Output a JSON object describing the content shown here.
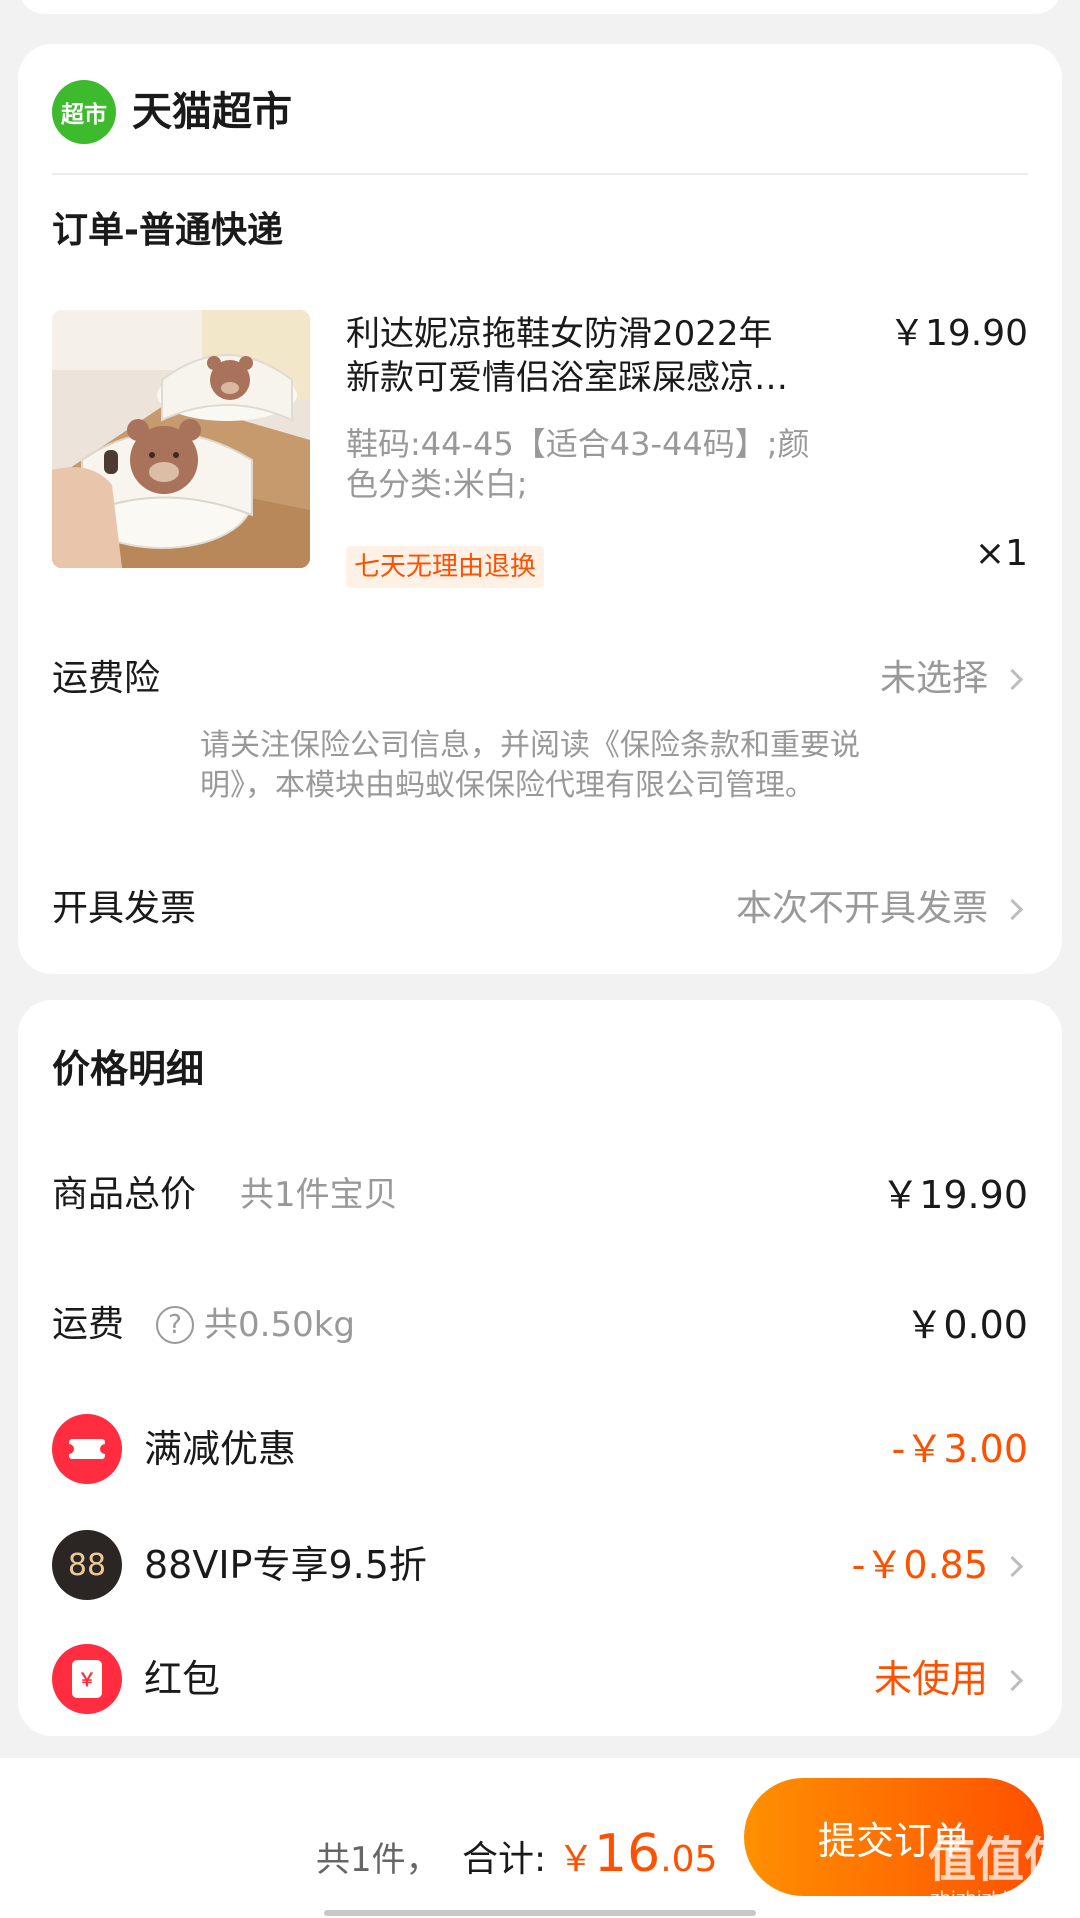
{
  "store": {
    "logo_text": "超市",
    "name": "天猫超市",
    "logo_color": "#3dbb2c"
  },
  "order": {
    "title": "订单-普通快递",
    "product": {
      "name_line1": "利达妮凉拖鞋女防滑2022年",
      "name_line2": "新款可爱情侣浴室踩屎感凉…",
      "price": "￥19.90",
      "spec_line1": "鞋码:44-45【适合43-44码】;颜",
      "spec_line2": "色分类:米白;",
      "tag": "七天无理由退换",
      "quantity": "×1"
    },
    "shipping_insurance": {
      "label": "运费险",
      "value": "未选择",
      "notice_line1": "请关注保险公司信息，并阅读《保险条款和重要说",
      "notice_line2": "明》，本模块由蚂蚁保保险代理有限公司管理。"
    },
    "invoice": {
      "label": "开具发票",
      "value": "本次不开具发票"
    }
  },
  "price_detail": {
    "title": "价格明细",
    "goods_total": {
      "label": "商品总价",
      "sub": "共1件宝贝",
      "value": "￥19.90"
    },
    "freight": {
      "label": "运费",
      "help_icon": "?",
      "sub": "共0.50kg",
      "value": "￥0.00"
    },
    "discount": {
      "icon": "coupon-icon",
      "label": "满减优惠",
      "value": "-￥3.00"
    },
    "vip": {
      "icon": "88",
      "label": "88VIP专享9.5折",
      "value": "-￥0.85"
    },
    "red_packet": {
      "icon": "￥",
      "label": "红包",
      "value": "未使用"
    }
  },
  "footer": {
    "count": "共1件，",
    "total_label": "合计:",
    "currency": "￥",
    "total_int": "16",
    "total_dec": ".05",
    "submit": "提交订单",
    "watermark_text": "值值值",
    "watermark_url": "zhizhizhi.com"
  },
  "colors": {
    "accent": "#ff5000",
    "button_start": "#ff9000",
    "button_end": "#ff5000",
    "muted": "#999999"
  }
}
